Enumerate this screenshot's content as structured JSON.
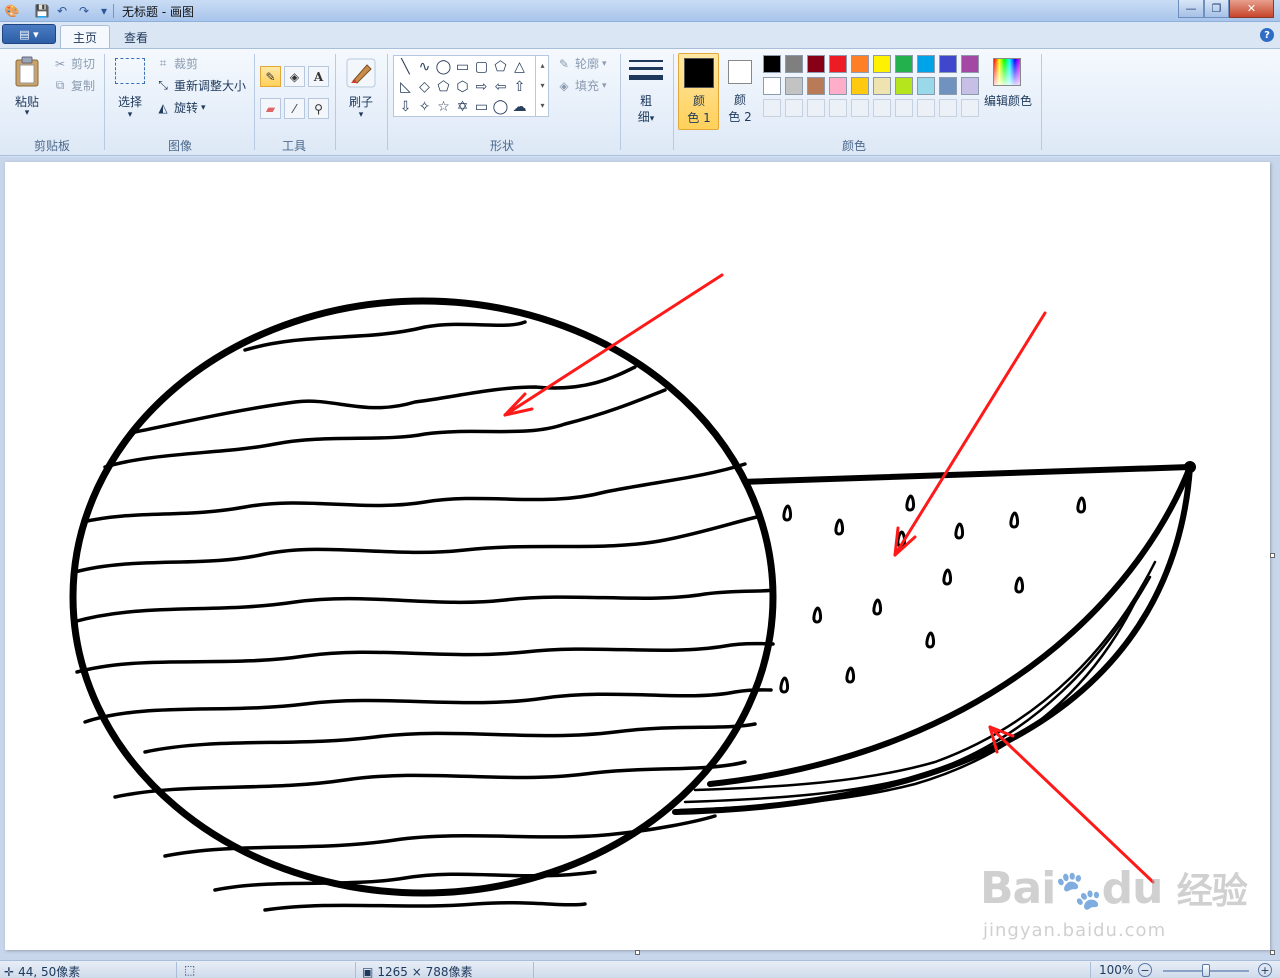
{
  "window": {
    "title": "无标题 - 画图"
  },
  "tabs": [
    {
      "label": "主页"
    },
    {
      "label": "查看"
    }
  ],
  "app_menu_icon": "document-menu-icon",
  "ribbon": {
    "clipboard": {
      "paste": "粘贴",
      "cut": "剪切",
      "copy": "复制",
      "label": "剪贴板"
    },
    "image": {
      "select": "选择",
      "crop": "裁剪",
      "resize": "重新调整大小",
      "rotate": "旋转",
      "label": "图像"
    },
    "tools": {
      "label": "工具"
    },
    "brushes": {
      "label": "刷子"
    },
    "shapes": {
      "outline": "轮廓",
      "fill": "填充",
      "label": "形状"
    },
    "size": {
      "label_top": "粗",
      "label_bottom": "细"
    },
    "colors": {
      "color1_top": "颜",
      "color1_bottom": "色 1",
      "color2_top": "颜",
      "color2_bottom": "色 2",
      "edit": "编辑颜色",
      "label": "颜色",
      "color1_value": "#000000",
      "color2_value": "#ffffff",
      "palette_row1": [
        "#000000",
        "#7f7f7f",
        "#880015",
        "#ed1c24",
        "#ff7f27",
        "#fff200",
        "#22b14c",
        "#00a2e8",
        "#3f48cc",
        "#a349a4"
      ],
      "palette_row2": [
        "#ffffff",
        "#c3c3c3",
        "#b97a57",
        "#ffaec9",
        "#ffc90e",
        "#efe4b0",
        "#b5e61d",
        "#99d9ea",
        "#7092be",
        "#c8bfe7"
      ]
    }
  },
  "status": {
    "cursor": "44, 50像素",
    "canvas_size": "1265 × 788像素",
    "zoom": "100%"
  },
  "watermark": {
    "brand": "Bai",
    "brand2": "du",
    "brand3": "经验",
    "url": "jingyan.baidu.com"
  }
}
